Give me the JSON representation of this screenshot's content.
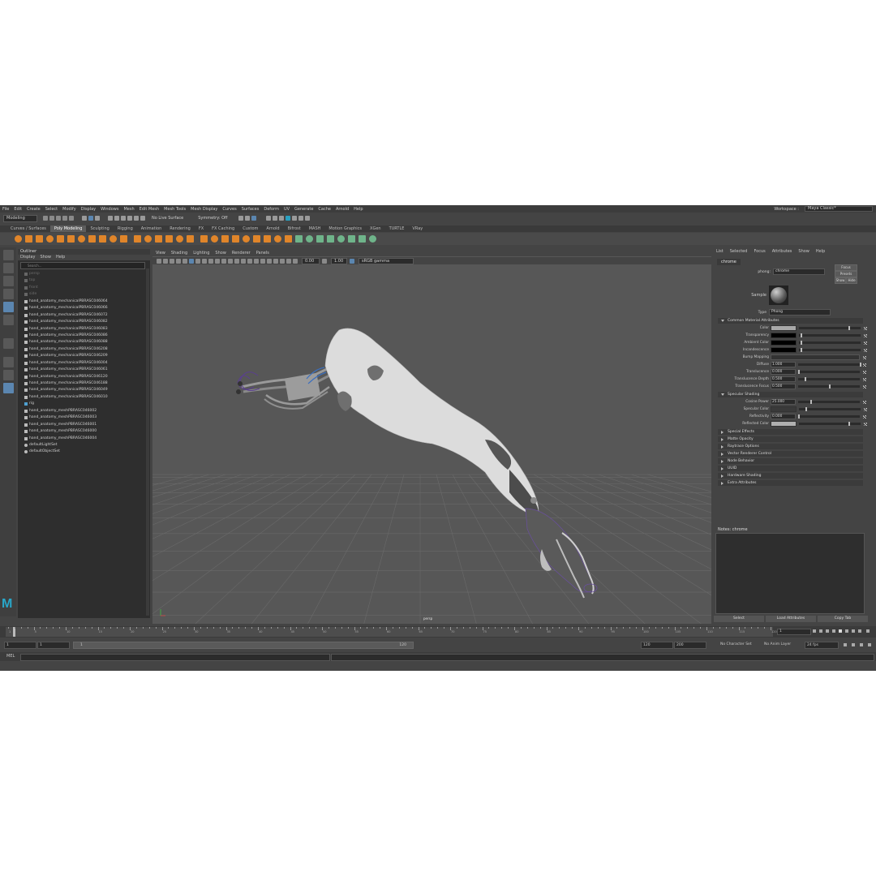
{
  "menubar": {
    "items": [
      "File",
      "Edit",
      "Create",
      "Select",
      "Modify",
      "Display",
      "Windows",
      "Mesh",
      "Edit Mesh",
      "Mesh Tools",
      "Mesh Display",
      "Curves",
      "Surfaces",
      "Deform",
      "UV",
      "Generate",
      "Cache",
      "Arnold",
      "Help"
    ],
    "workspace_label": "Workspace :",
    "workspace_value": "Maya Classic*"
  },
  "statusline": {
    "mode": "Modeling",
    "live_surface": "No Live Surface",
    "symmetry": "Symmetry: Off"
  },
  "shelf_tabs": [
    {
      "label": "Curves / Surfaces",
      "active": false
    },
    {
      "label": "Poly Modeling",
      "active": true
    },
    {
      "label": "Sculpting",
      "active": false
    },
    {
      "label": "Rigging",
      "active": false
    },
    {
      "label": "Animation",
      "active": false
    },
    {
      "label": "Rendering",
      "active": false
    },
    {
      "label": "FX",
      "active": false
    },
    {
      "label": "FX Caching",
      "active": false
    },
    {
      "label": "Custom",
      "active": false
    },
    {
      "label": "Arnold",
      "active": false
    },
    {
      "label": "Bifrost",
      "active": false
    },
    {
      "label": "MASH",
      "active": false
    },
    {
      "label": "Motion Graphics",
      "active": false
    },
    {
      "label": "XGen",
      "active": false
    },
    {
      "label": "TURTLE",
      "active": false
    },
    {
      "label": "VRay",
      "active": false
    }
  ],
  "outliner": {
    "title": "Outliner",
    "menu": [
      "Display",
      "Show",
      "Help"
    ],
    "search_placeholder": "Search...",
    "items": [
      {
        "label": "persp",
        "dim": true
      },
      {
        "label": "top",
        "dim": true
      },
      {
        "label": "front",
        "dim": true
      },
      {
        "label": "side",
        "dim": true
      },
      {
        "label": "hand_anatomy_mechanicalPBRASC046064",
        "dim": false
      },
      {
        "label": "hand_anatomy_mechanicalPBRASC046066",
        "dim": false
      },
      {
        "label": "hand_anatomy_mechanicalPBRASC046072",
        "dim": false
      },
      {
        "label": "hand_anatomy_mechanicalPBRASC046082",
        "dim": false
      },
      {
        "label": "hand_anatomy_mechanicalPBRASC046083",
        "dim": false
      },
      {
        "label": "hand_anatomy_mechanicalPBRASC046086",
        "dim": false
      },
      {
        "label": "hand_anatomy_mechanicalPBRASC046088",
        "dim": false
      },
      {
        "label": "hand_anatomy_mechanicalPBRASC046208",
        "dim": false
      },
      {
        "label": "hand_anatomy_mechanicalPBRASC046209",
        "dim": false
      },
      {
        "label": "hand_anatomy_mechanicalPBRASC046004",
        "dim": false
      },
      {
        "label": "hand_anatomy_mechanicalPBRASC046061",
        "dim": false
      },
      {
        "label": "hand_anatomy_mechanicalPBRASC046120",
        "dim": false
      },
      {
        "label": "hand_anatomy_mechanicalPBRASC046188",
        "dim": false
      },
      {
        "label": "hand_anatomy_mechanicalPBRASC046049",
        "dim": false
      },
      {
        "label": "hand_anatomy_mechanicalPBRASC046010",
        "dim": false
      },
      {
        "label": "rig",
        "dim": false
      },
      {
        "label": "hand_anatomy_meshPBRASC046002",
        "dim": false
      },
      {
        "label": "hand_anatomy_meshPBRASC046003",
        "dim": false
      },
      {
        "label": "hand_anatomy_meshPBRASC046001",
        "dim": false
      },
      {
        "label": "hand_anatomy_meshPBRASC046000",
        "dim": false
      },
      {
        "label": "hand_anatomy_meshPBRASC046004",
        "dim": false
      },
      {
        "label": "defaultLightSet",
        "dim": false
      },
      {
        "label": "defaultObjectSet",
        "dim": false
      }
    ]
  },
  "viewport": {
    "menu": [
      "View",
      "Shading",
      "Lighting",
      "Show",
      "Renderer",
      "Panels"
    ],
    "exposure": "0.00",
    "gamma": "1.00",
    "color_space": "sRGB gamma",
    "camera": "persp"
  },
  "attribute_editor": {
    "menu": [
      "List",
      "Selected",
      "Focus",
      "Attributes",
      "Show",
      "Help"
    ],
    "tab": "chrome",
    "node_label": "phong:",
    "node_value": "chrome",
    "focus": "Focus",
    "presets": "Presets",
    "show": "Show",
    "hide": "Hide",
    "sample_label": "Sample",
    "type_label": "Type",
    "type_value": "Phong",
    "sections": [
      {
        "title": "Common Material Attributes",
        "open": true,
        "rows": [
          {
            "label": "Color",
            "swatch": "#a8a8a8",
            "knob": 0.8
          },
          {
            "label": "Transparency",
            "swatch": "#000000",
            "knob": 0.02
          },
          {
            "label": "Ambient Color",
            "swatch": "#000000",
            "knob": 0.02
          },
          {
            "label": "Incandescence",
            "swatch": "#000000",
            "knob": 0.02
          },
          {
            "label": "Bump Mapping"
          },
          {
            "label": "Diffuse",
            "value": "1.000",
            "knob": 1.0
          },
          {
            "label": "Translucence",
            "value": "0.000",
            "knob": 0.0
          },
          {
            "label": "Translucence Depth",
            "value": "0.500",
            "knob": 0.1
          },
          {
            "label": "Translucence Focus",
            "value": "0.500",
            "knob": 0.5
          }
        ]
      },
      {
        "title": "Specular Shading",
        "open": true,
        "rows": [
          {
            "label": "Cosine Power",
            "value": "25.000",
            "knob": 0.2
          },
          {
            "label": "Specular Color",
            "swatch": "#3a3a3a",
            "knob": 0.1
          },
          {
            "label": "Reflectivity",
            "value": "0.000",
            "knob": 0.0
          },
          {
            "label": "Reflected Color",
            "swatch": "#b0b0b0",
            "knob": 0.8
          }
        ]
      },
      {
        "title": "Special Effects",
        "open": false
      },
      {
        "title": "Matte Opacity",
        "open": false
      },
      {
        "title": "Raytrace Options",
        "open": false
      },
      {
        "title": "Vector Renderer Control",
        "open": false
      },
      {
        "title": "Node Behavior",
        "open": false
      },
      {
        "title": "UUID",
        "open": false
      },
      {
        "title": "Hardware Shading",
        "open": false
      },
      {
        "title": "Extra Attributes",
        "open": false
      }
    ],
    "notes_label": "Notes: chrome",
    "buttons": [
      "Select",
      "Load Attributes",
      "Copy Tab"
    ]
  },
  "timeslider": {
    "current_frame": "1",
    "ticks": [
      "1",
      "5",
      "10",
      "15",
      "20",
      "25",
      "30",
      "35",
      "40",
      "45",
      "50",
      "55",
      "60",
      "65",
      "70",
      "75",
      "80",
      "85",
      "90",
      "95",
      "100",
      "105",
      "110",
      "115",
      "120"
    ]
  },
  "rangeslider": {
    "start": "1",
    "anim_start": "1",
    "range_start": "1",
    "range_end": "120",
    "anim_end": "120",
    "end": "200",
    "character_set": "No Character Set",
    "anim_layer": "No Anim Layer",
    "fps": "24 fps"
  },
  "cmdline": {
    "label": "MEL"
  },
  "colors": {
    "app_bg": "#444444",
    "viewport_bg": "#575757",
    "accent": "#5b86b0",
    "shelf_icon": "#e0852a",
    "logo": "#29a6c8"
  }
}
